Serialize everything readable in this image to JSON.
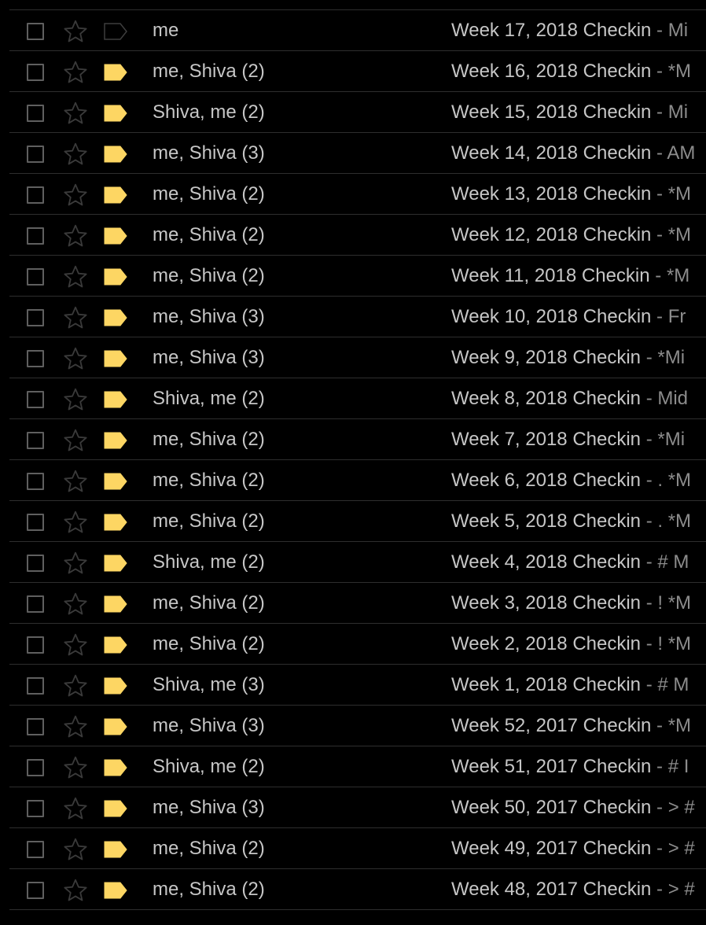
{
  "colors": {
    "background": "#000000",
    "divider": "#2e2e2e",
    "text": "#c6c6c6",
    "snippet": "#8c8c8c",
    "important_marker": "#fdd663",
    "marker_outline": "#5f5f5f",
    "star_outline": "#3a3a3a",
    "checkbox_border": "#5f5f5f"
  },
  "icons": {
    "checkbox": "checkbox-icon",
    "star": "star-icon",
    "importance": "importance-marker-icon"
  },
  "threads": [
    {
      "sender": "me",
      "subject": "Week 17, 2018 Checkin",
      "snippet": " - Mi",
      "important": false
    },
    {
      "sender": "me, Shiva (2)",
      "subject": "Week 16, 2018 Checkin",
      "snippet": " - *M",
      "important": true
    },
    {
      "sender": "Shiva, me (2)",
      "subject": "Week 15, 2018 Checkin",
      "snippet": " - Mi",
      "important": true
    },
    {
      "sender": "me, Shiva (3)",
      "subject": "Week 14, 2018 Checkin",
      "snippet": " - AM",
      "important": true
    },
    {
      "sender": "me, Shiva (2)",
      "subject": "Week 13, 2018 Checkin",
      "snippet": " - *M",
      "important": true
    },
    {
      "sender": "me, Shiva (2)",
      "subject": "Week 12, 2018 Checkin",
      "snippet": " - *M",
      "important": true
    },
    {
      "sender": "me, Shiva (2)",
      "subject": "Week 11, 2018 Checkin",
      "snippet": " - *M",
      "important": true
    },
    {
      "sender": "me, Shiva (3)",
      "subject": "Week 10, 2018 Checkin",
      "snippet": " - Fr",
      "important": true
    },
    {
      "sender": "me, Shiva (3)",
      "subject": "Week 9, 2018 Checkin",
      "snippet": " - *Mi",
      "important": true
    },
    {
      "sender": "Shiva, me (2)",
      "subject": "Week 8, 2018 Checkin",
      "snippet": " - Mid",
      "important": true
    },
    {
      "sender": "me, Shiva (2)",
      "subject": "Week 7, 2018 Checkin",
      "snippet": " - *Mi",
      "important": true
    },
    {
      "sender": "me, Shiva (2)",
      "subject": "Week 6, 2018 Checkin",
      "snippet": " - . *M",
      "important": true
    },
    {
      "sender": "me, Shiva (2)",
      "subject": "Week 5, 2018 Checkin",
      "snippet": " - . *M",
      "important": true
    },
    {
      "sender": "Shiva, me (2)",
      "subject": "Week 4, 2018 Checkin",
      "snippet": " - # M",
      "important": true
    },
    {
      "sender": "me, Shiva (2)",
      "subject": "Week 3, 2018 Checkin",
      "snippet": " - ! *M",
      "important": true
    },
    {
      "sender": "me, Shiva (2)",
      "subject": "Week 2, 2018 Checkin",
      "snippet": " - ! *M",
      "important": true
    },
    {
      "sender": "Shiva, me (3)",
      "subject": "Week 1, 2018 Checkin",
      "snippet": " - # M",
      "important": true
    },
    {
      "sender": "me, Shiva (3)",
      "subject": "Week 52, 2017 Checkin",
      "snippet": " - *M",
      "important": true
    },
    {
      "sender": "Shiva, me (2)",
      "subject": "Week 51, 2017 Checkin",
      "snippet": " - # I",
      "important": true
    },
    {
      "sender": "me, Shiva (3)",
      "subject": "Week 50, 2017 Checkin",
      "snippet": " - > #",
      "important": true
    },
    {
      "sender": "me, Shiva (2)",
      "subject": "Week 49, 2017 Checkin",
      "snippet": " - > #",
      "important": true
    },
    {
      "sender": "me, Shiva (2)",
      "subject": "Week 48, 2017 Checkin",
      "snippet": " - > #",
      "important": true
    }
  ]
}
